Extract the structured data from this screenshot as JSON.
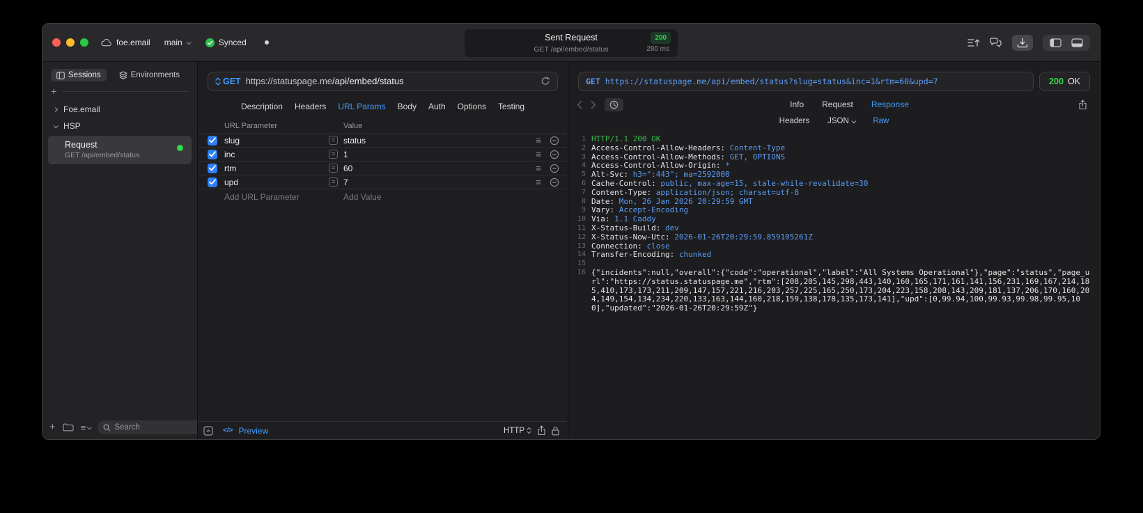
{
  "colors": {
    "accent": "#409cff",
    "code_blue": "#5b9cf5",
    "green": "#32d74b",
    "status_green": "#3cb94e"
  },
  "titlebar": {
    "cloud_label": "foe.email",
    "branch": "main",
    "sync_status": "Synced",
    "center": {
      "title": "Sent Request",
      "status_code": "200",
      "subtitle": "GET /api/embed/status",
      "duration": "280 ms"
    }
  },
  "sidebar": {
    "tabs": [
      {
        "label": "Sessions"
      },
      {
        "label": "Environments"
      }
    ],
    "active_tab": "Sessions",
    "tree": [
      {
        "label": "Foe.email",
        "expanded": false
      },
      {
        "label": "HSP",
        "expanded": true
      }
    ],
    "selected_request": {
      "name": "Request",
      "subtitle": "GET /api/embed/status"
    },
    "search_placeholder": "Search"
  },
  "request": {
    "method": "GET",
    "url_host": "https://statuspage.me",
    "url_path": "/api/embed/status",
    "tabs": [
      "Description",
      "Headers",
      "URL Params",
      "Body",
      "Auth",
      "Options",
      "Testing"
    ],
    "active_tab": "URL Params",
    "params": {
      "col_name": "URL Parameter",
      "col_value": "Value",
      "rows": [
        {
          "name": "slug",
          "value": "status",
          "enabled": true
        },
        {
          "name": "inc",
          "value": "1",
          "enabled": true
        },
        {
          "name": "rtm",
          "value": "60",
          "enabled": true
        },
        {
          "name": "upd",
          "value": "7",
          "enabled": true
        }
      ],
      "add_name_placeholder": "Add URL Parameter",
      "add_value_placeholder": "Add Value"
    },
    "footer": {
      "code_glyph": "</>",
      "preview_label": "Preview",
      "http_label": "HTTP"
    }
  },
  "response": {
    "request_line": {
      "method": "GET",
      "url": "https://statuspage.me/api/embed/status?slug=status&inc=1&rtm=60&upd=7"
    },
    "status": {
      "code": "200",
      "text": "OK"
    },
    "tabs": [
      "Info",
      "Request",
      "Response"
    ],
    "active_tab": "Response",
    "subtabs": [
      "Headers",
      "JSON",
      "Raw"
    ],
    "active_subtab": "Raw",
    "lines": [
      {
        "num": "1",
        "kind": "status",
        "text": "HTTP/1.1 200 OK"
      },
      {
        "num": "2",
        "kind": "header",
        "name": "Access-Control-Allow-Headers",
        "value": "Content-Type"
      },
      {
        "num": "3",
        "kind": "header",
        "name": "Access-Control-Allow-Methods",
        "value": "GET, OPTIONS"
      },
      {
        "num": "4",
        "kind": "header",
        "name": "Access-Control-Allow-Origin",
        "value": "*"
      },
      {
        "num": "5",
        "kind": "header",
        "name": "Alt-Svc",
        "value": "h3=\":443\"; ma=2592000"
      },
      {
        "num": "6",
        "kind": "header",
        "name": "Cache-Control",
        "value": "public, max-age=15, stale-while-revalidate=30"
      },
      {
        "num": "7",
        "kind": "header",
        "name": "Content-Type",
        "value": "application/json; charset=utf-8"
      },
      {
        "num": "8",
        "kind": "header",
        "name": "Date",
        "value": "Mon, 26 Jan 2026 20:29:59 GMT"
      },
      {
        "num": "9",
        "kind": "header",
        "name": "Vary",
        "value": "Accept-Encoding"
      },
      {
        "num": "10",
        "kind": "header",
        "name": "Via",
        "value": "1.1 Caddy"
      },
      {
        "num": "11",
        "kind": "header",
        "name": "X-Status-Build",
        "value": "dev"
      },
      {
        "num": "12",
        "kind": "header",
        "name": "X-Status-Now-Utc",
        "value": "2026-01-26T20:29:59.859105261Z"
      },
      {
        "num": "13",
        "kind": "header",
        "name": "Connection",
        "value": "close"
      },
      {
        "num": "14",
        "kind": "header",
        "name": "Transfer-Encoding",
        "value": "chunked"
      },
      {
        "num": "15",
        "kind": "blank",
        "text": ""
      },
      {
        "num": "16",
        "kind": "body",
        "text": "{\"incidents\":null,\"overall\":{\"code\":\"operational\",\"label\":\"All Systems Operational\"},\"page\":\"status\",\"page_url\":\"https://status.statuspage.me\",\"rtm\":[208,205,145,298,443,140,160,165,171,161,141,156,231,169,167,214,185,410,173,173,211,209,147,157,221,216,203,257,225,165,250,173,204,223,158,208,143,209,181,137,206,170,160,204,149,154,134,234,220,133,163,144,160,218,159,138,178,135,173,141],\"upd\":[0,99.94,100,99.93,99.98,99.95,100],\"updated\":\"2026-01-26T20:29:59Z\"}"
      }
    ]
  },
  "icons": {
    "drag_handle": "≡",
    "plus": "+"
  }
}
